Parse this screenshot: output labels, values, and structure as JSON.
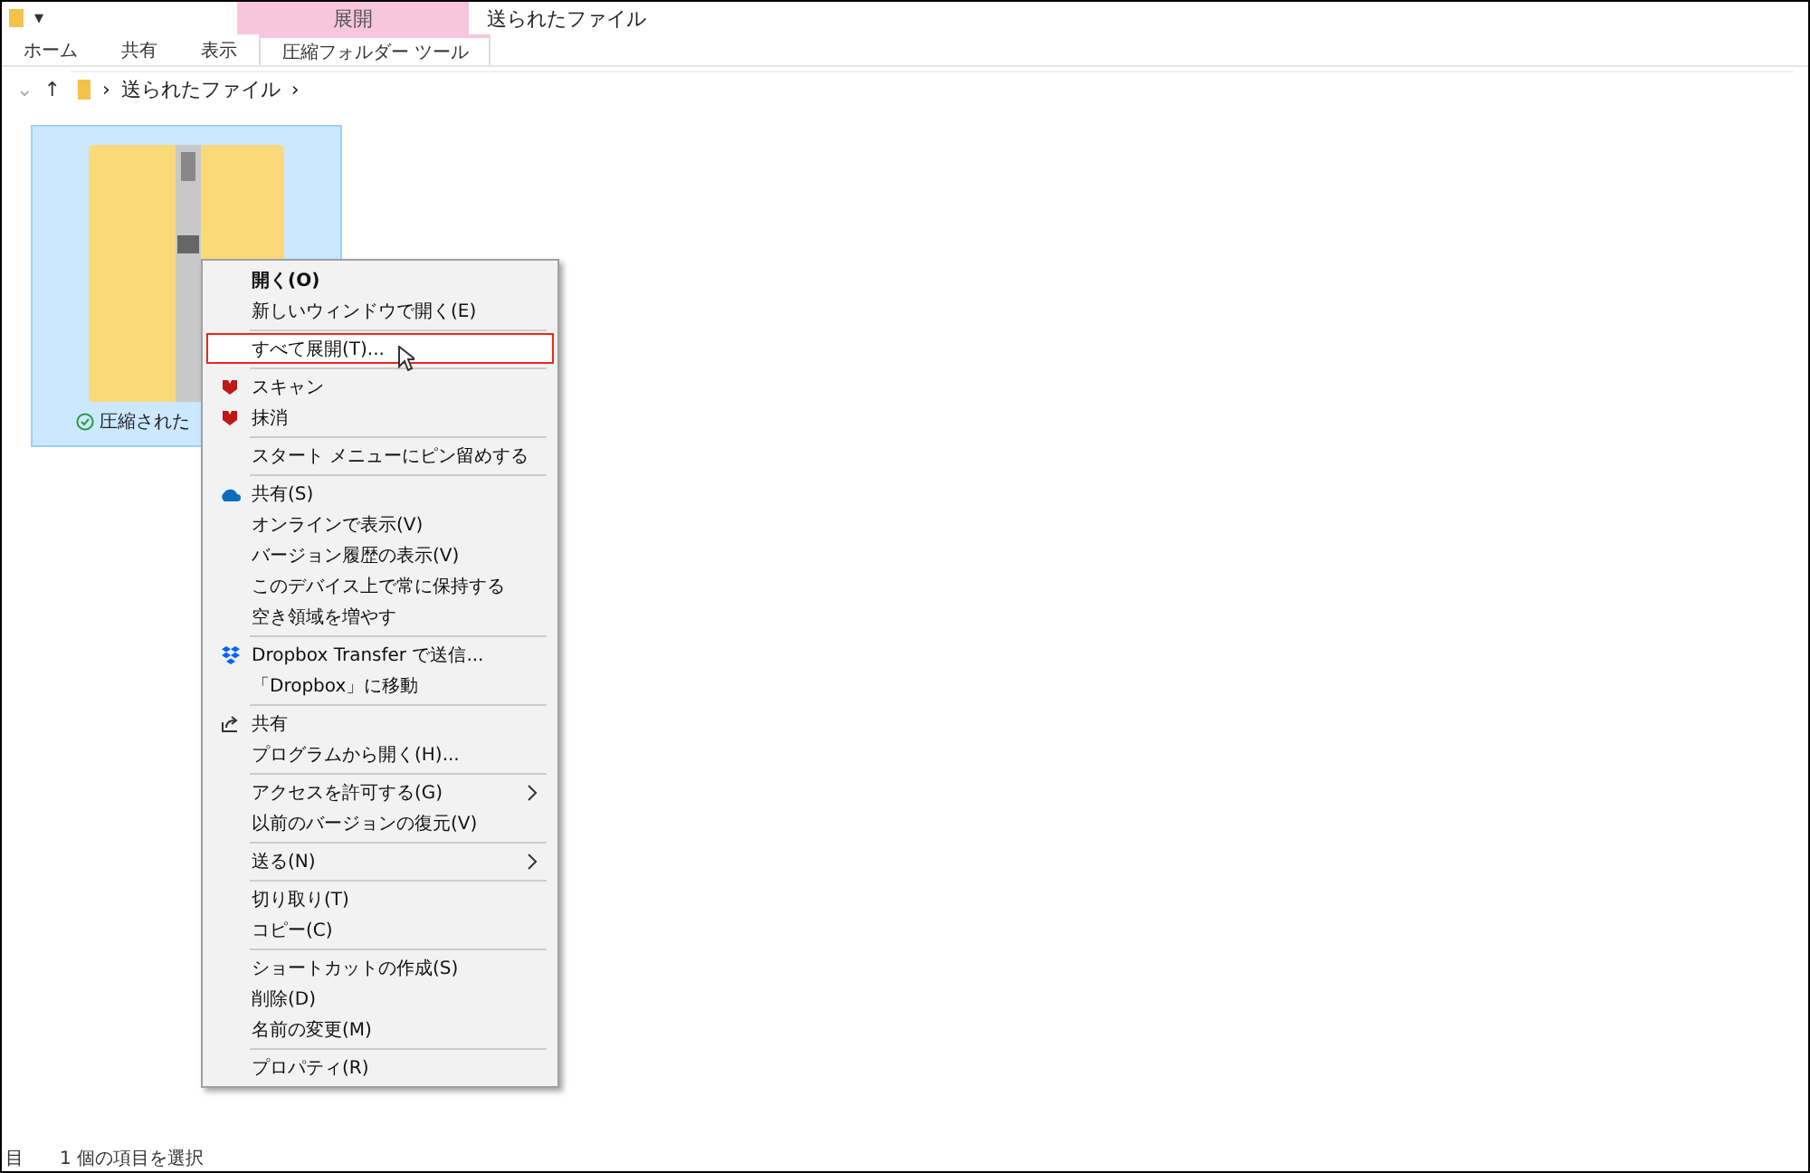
{
  "title_bar": {
    "quick_access": "▾",
    "context_tab_group": "展開",
    "title": "送られたファイル"
  },
  "ribbon_tabs": [
    {
      "label": "ホーム",
      "selected": false,
      "contextual": false
    },
    {
      "label": "共有",
      "selected": false,
      "contextual": false
    },
    {
      "label": "表示",
      "selected": false,
      "contextual": false
    },
    {
      "label": "圧縮フォルダー ツール",
      "selected": false,
      "contextual": true
    }
  ],
  "address_bar": {
    "back": "⌄",
    "up": "↑",
    "path": [
      {
        "label": "›"
      },
      {
        "label": "送られたファイル"
      },
      {
        "label": "›"
      }
    ]
  },
  "files": [
    {
      "name": "圧縮された",
      "selected": true,
      "synced": true
    }
  ],
  "context_menu": {
    "items": [
      {
        "kind": "item",
        "label": "開く(O)",
        "bold": true
      },
      {
        "kind": "item",
        "label": "新しいウィンドウで開く(E)"
      },
      {
        "kind": "separator"
      },
      {
        "kind": "item",
        "label": "すべて展開(T)...",
        "selected": true
      },
      {
        "kind": "separator"
      },
      {
        "kind": "shield",
        "label": "スキャン"
      },
      {
        "kind": "shield",
        "label": "抹消"
      },
      {
        "kind": "separator"
      },
      {
        "kind": "item",
        "label": "スタート メニューにピン留めする"
      },
      {
        "kind": "separator"
      },
      {
        "kind": "cloud",
        "label": "共有(S)"
      },
      {
        "kind": "item",
        "label": "オンラインで表示(V)"
      },
      {
        "kind": "item",
        "label": "バージョン履歴の表示(V)"
      },
      {
        "kind": "item",
        "label": "このデバイス上で常に保持する"
      },
      {
        "kind": "item",
        "label": "空き領域を増やす"
      },
      {
        "kind": "separator"
      },
      {
        "kind": "dropbox",
        "label": "Dropbox Transfer で送信..."
      },
      {
        "kind": "item",
        "label": "「Dropbox」に移動"
      },
      {
        "kind": "separator"
      },
      {
        "kind": "share",
        "label": "共有"
      },
      {
        "kind": "item",
        "label": "プログラムから開く(H)..."
      },
      {
        "kind": "separator"
      },
      {
        "kind": "item",
        "label": "アクセスを許可する(G)",
        "submenu": true
      },
      {
        "kind": "item",
        "label": "以前のバージョンの復元(V)"
      },
      {
        "kind": "separator"
      },
      {
        "kind": "item",
        "label": "送る(N)",
        "submenu": true
      },
      {
        "kind": "separator"
      },
      {
        "kind": "item",
        "label": "切り取り(T)"
      },
      {
        "kind": "item",
        "label": "コピー(C)"
      },
      {
        "kind": "separator"
      },
      {
        "kind": "item",
        "label": "ショートカットの作成(S)"
      },
      {
        "kind": "item",
        "label": "削除(D)"
      },
      {
        "kind": "item",
        "label": "名前の変更(M)"
      },
      {
        "kind": "separator"
      },
      {
        "kind": "item",
        "label": "プロパティ(R)"
      }
    ]
  },
  "status_bar": [
    "目",
    "1 個の項目を選択"
  ]
}
